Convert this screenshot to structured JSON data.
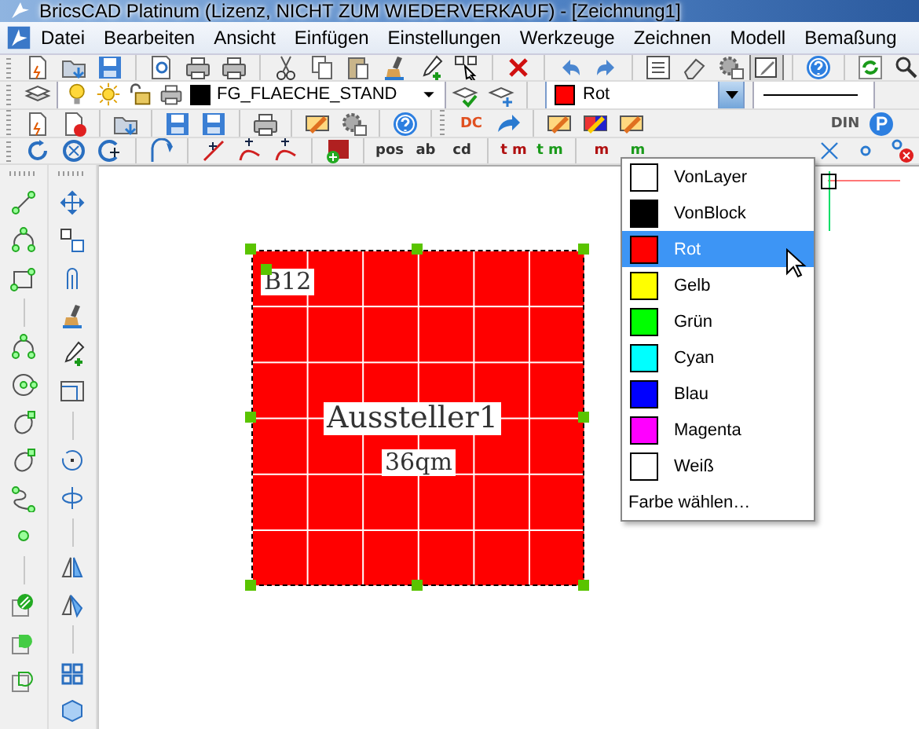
{
  "window": {
    "title": "BricsCAD Platinum (Lizenz, NICHT ZUM WIEDERVERKAUF) - [Zeichnung1]"
  },
  "menu": [
    {
      "label": "Datei"
    },
    {
      "label": "Bearbeiten"
    },
    {
      "label": "Ansicht"
    },
    {
      "label": "Einfügen"
    },
    {
      "label": "Einstellungen"
    },
    {
      "label": "Werkzeuge"
    },
    {
      "label": "Zeichnen"
    },
    {
      "label": "Modell"
    },
    {
      "label": "Bemaßung"
    }
  ],
  "layer": {
    "name": "FG_FLAECHE_STAND",
    "color": "#000000"
  },
  "color_combo": {
    "value": "Rot",
    "color": "#ff0000",
    "expanded": true
  },
  "color_list": [
    {
      "label": "VonLayer",
      "color": "#ffffff",
      "selected": false
    },
    {
      "label": "VonBlock",
      "color": "#000000",
      "selected": false
    },
    {
      "label": "Rot",
      "color": "#ff0000",
      "selected": true
    },
    {
      "label": "Gelb",
      "color": "#ffff00",
      "selected": false
    },
    {
      "label": "Grün",
      "color": "#00ff00",
      "selected": false
    },
    {
      "label": "Cyan",
      "color": "#00ffff",
      "selected": false
    },
    {
      "label": "Blau",
      "color": "#0000ff",
      "selected": false
    },
    {
      "label": "Magenta",
      "color": "#ff00ff",
      "selected": false
    },
    {
      "label": "Weiß",
      "color": "#ffffff",
      "selected": false
    }
  ],
  "choose_color": "Farbe wählen…",
  "toolbar_labels": {
    "dc": "DC",
    "din": "DIN",
    "pos": "pos",
    "ab": "ab",
    "cd": "cd",
    "t1": "t",
    "m1": "m",
    "t2": "t",
    "m2": "m",
    "m3": "m",
    "m4": "m"
  },
  "drawing": {
    "booth_number": "B12",
    "exhibitor": "Aussteller1",
    "area": "36qm",
    "color": "#ff0000",
    "selected": true
  }
}
